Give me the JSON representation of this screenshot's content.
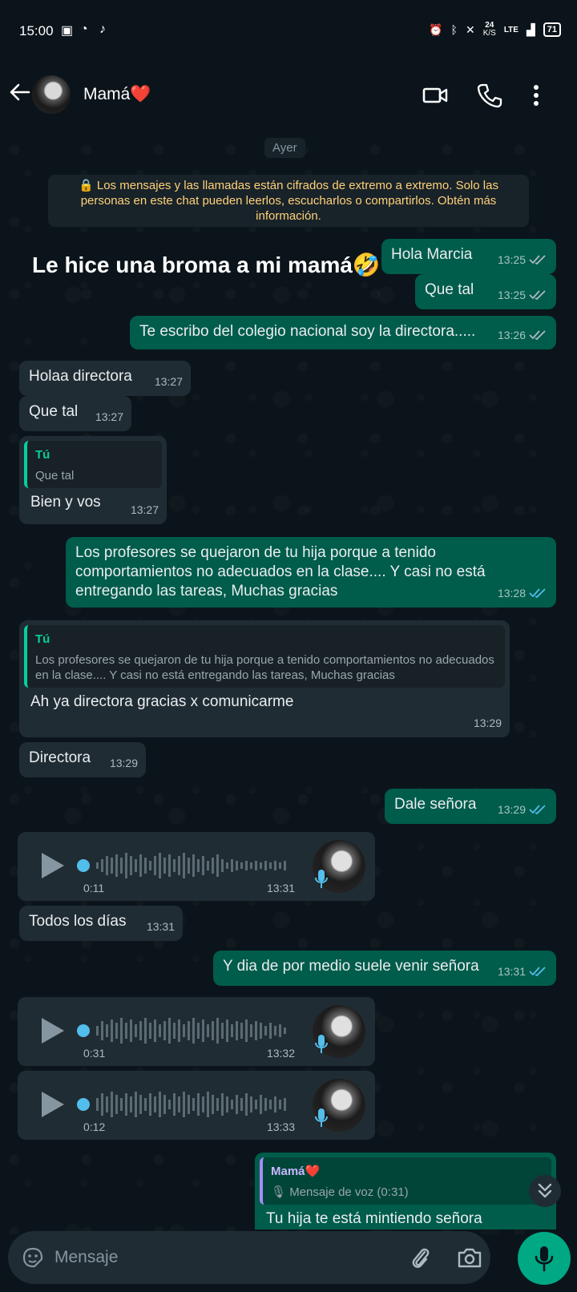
{
  "status_bar": {
    "time": "15:00",
    "network_speed": "24",
    "network_unit": "K/S",
    "network_type": "LTE",
    "battery": "71"
  },
  "header": {
    "contact_name": "Mamá❤️"
  },
  "chat": {
    "date_chip": "Ayer",
    "encryption_note": "🔒 Los mensajes y las llamadas están cifrados de extremo a extremo. Solo las personas en este chat pueden leerlos, escucharlos o compartirlos. Obtén más información.",
    "overlay_caption": "Le hice una broma a mi mamá🤣",
    "messages": [
      {
        "text": "Hola Marcia",
        "time": "13:25"
      },
      {
        "text": "Que tal",
        "time": "13:25"
      },
      {
        "text": "Te escribo del colegio nacional soy la directora.....",
        "time": "13:26"
      },
      {
        "text": "Holaa directora",
        "time": "13:27"
      },
      {
        "text": "Que tal",
        "time": "13:27"
      },
      {
        "quote_author": "Tú",
        "quote_text": "Que tal",
        "text": "Bien y vos",
        "time": "13:27"
      },
      {
        "text": "Los profesores se quejaron de tu hija porque a tenido comportamientos no adecuados en la clase.... Y casi no  está entregando las tareas, Muchas gracias",
        "time": "13:28"
      },
      {
        "quote_author": "Tú",
        "quote_text": "Los profesores se quejaron de tu hija porque a tenido comportamientos no adecuados en la clase.... Y casi no  está entregando las tareas, Muchas gracias",
        "text": "Ah ya directora gracias x comunicarme",
        "time": "13:29"
      },
      {
        "text": "Directora",
        "time": "13:29"
      },
      {
        "text": "Dale señora",
        "time": "13:29"
      },
      {
        "voice_duration": "0:11",
        "time": "13:31"
      },
      {
        "text": "Todos los días",
        "time": "13:31"
      },
      {
        "text": "Y dia de por medio suele venir señora",
        "time": "13:31"
      },
      {
        "voice_duration": "0:31",
        "time": "13:32"
      },
      {
        "voice_duration": "0:12",
        "time": "13:33"
      },
      {
        "quote_author": "Mamá❤️",
        "quote_text": "🎙 Mensaje de voz (0:31)",
        "text": "Tu hija te está mintiendo señora"
      }
    ]
  },
  "composer": {
    "placeholder": "Mensaje"
  },
  "colors": {
    "background": "#0b141a",
    "incoming_bubble": "#202c33",
    "outgoing_bubble": "#005c4b",
    "accent": "#00a884",
    "read_ticks": "#53bdeb"
  }
}
